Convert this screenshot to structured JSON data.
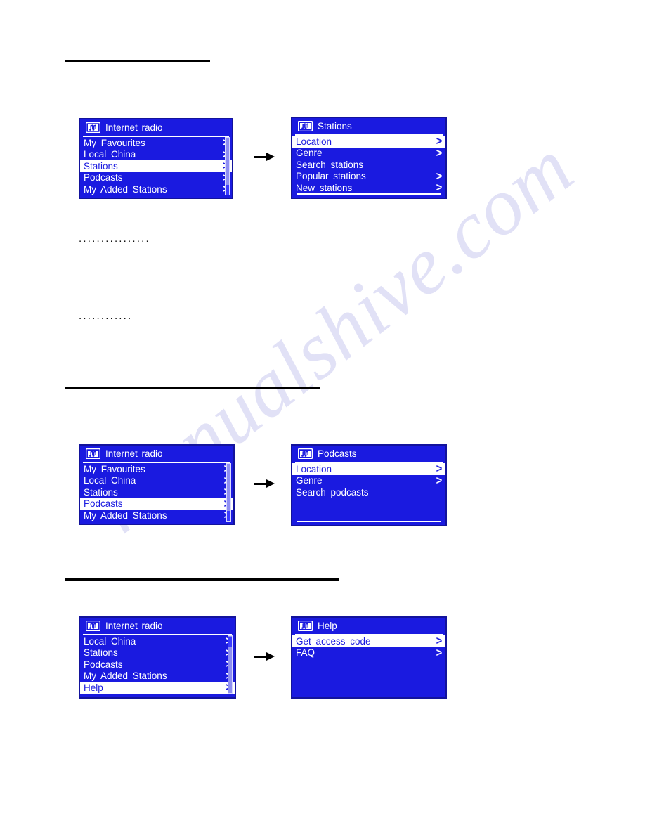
{
  "page": {
    "watermark": "manualshive.com",
    "background_color": "#ffffff",
    "rule_color": "#000000"
  },
  "lcd_theme": {
    "screen_blue": "#1a1ae0",
    "border_blue": "#13139c",
    "text_white": "#ffffff",
    "selected_bg": "#ffffff",
    "selected_text": "#1a1ae0",
    "scrollbar_track": "#8e8ef2",
    "scrollbar_thumb": "#3b3bff"
  },
  "redacted_rows": [
    {
      "dots": "................"
    },
    {
      "dots": "............"
    }
  ],
  "flow_arrows": [
    {
      "name": "arrow-stations"
    },
    {
      "name": "arrow-podcasts"
    },
    {
      "name": "arrow-help"
    }
  ],
  "screens": [
    {
      "id": "internet-radio-stations",
      "icon": "internet-radio-icon",
      "title": "Internet  radio",
      "rows": [
        {
          "label": "My  Favourites",
          "chevron": true,
          "selected": false
        },
        {
          "label": "Local  China",
          "chevron": true,
          "selected": false
        },
        {
          "label": "Stations",
          "chevron": true,
          "selected": true
        },
        {
          "label": "Podcasts",
          "chevron": true,
          "selected": false
        },
        {
          "label": "My  Added  Stations",
          "chevron": true,
          "selected": false
        }
      ],
      "scrollbar": {
        "visible": true,
        "thumb_position": "bottom"
      },
      "bottom_rule": false
    },
    {
      "id": "stations-menu",
      "icon": "internet-radio-icon",
      "title": "Stations",
      "rows": [
        {
          "label": "Location",
          "chevron": true,
          "selected": true
        },
        {
          "label": "Genre",
          "chevron": true,
          "selected": false
        },
        {
          "label": "Search  stations",
          "chevron": false,
          "selected": false
        },
        {
          "label": "Popular  stations",
          "chevron": true,
          "selected": false
        },
        {
          "label": "New  stations",
          "chevron": true,
          "selected": false
        }
      ],
      "scrollbar": {
        "visible": false,
        "thumb_position": "top"
      },
      "bottom_rule": true
    },
    {
      "id": "internet-radio-podcasts",
      "icon": "internet-radio-icon",
      "title": "Internet  radio",
      "rows": [
        {
          "label": "My  Favourites",
          "chevron": true,
          "selected": false
        },
        {
          "label": "Local  China",
          "chevron": true,
          "selected": false
        },
        {
          "label": "Stations",
          "chevron": true,
          "selected": false
        },
        {
          "label": "Podcasts",
          "chevron": true,
          "selected": true
        },
        {
          "label": "My  Added  Stations",
          "chevron": true,
          "selected": false
        }
      ],
      "scrollbar": {
        "visible": true,
        "thumb_position": "bottom"
      },
      "bottom_rule": false
    },
    {
      "id": "podcasts-menu",
      "icon": "internet-radio-icon",
      "title": "Podcasts",
      "rows": [
        {
          "label": "Location",
          "chevron": true,
          "selected": true
        },
        {
          "label": "Genre",
          "chevron": true,
          "selected": false
        },
        {
          "label": "Search  podcasts",
          "chevron": false,
          "selected": false
        }
      ],
      "scrollbar": {
        "visible": false,
        "thumb_position": "top"
      },
      "bottom_rule": true
    },
    {
      "id": "internet-radio-help",
      "icon": "internet-radio-icon",
      "title": "Internet  radio",
      "rows": [
        {
          "label": "Local  China",
          "chevron": true,
          "selected": false
        },
        {
          "label": "Stations",
          "chevron": true,
          "selected": false
        },
        {
          "label": "Podcasts",
          "chevron": true,
          "selected": false
        },
        {
          "label": "My  Added  Stations",
          "chevron": true,
          "selected": false
        },
        {
          "label": "Help",
          "chevron": true,
          "selected": true
        }
      ],
      "scrollbar": {
        "visible": true,
        "thumb_position": "top"
      },
      "bottom_rule": false
    },
    {
      "id": "help-menu",
      "icon": "internet-radio-icon",
      "title": "Help",
      "rows": [
        {
          "label": "Get  access  code",
          "chevron": true,
          "selected": true
        },
        {
          "label": "FAQ",
          "chevron": true,
          "selected": false
        }
      ],
      "scrollbar": {
        "visible": false,
        "thumb_position": "top"
      },
      "bottom_rule": false
    }
  ]
}
